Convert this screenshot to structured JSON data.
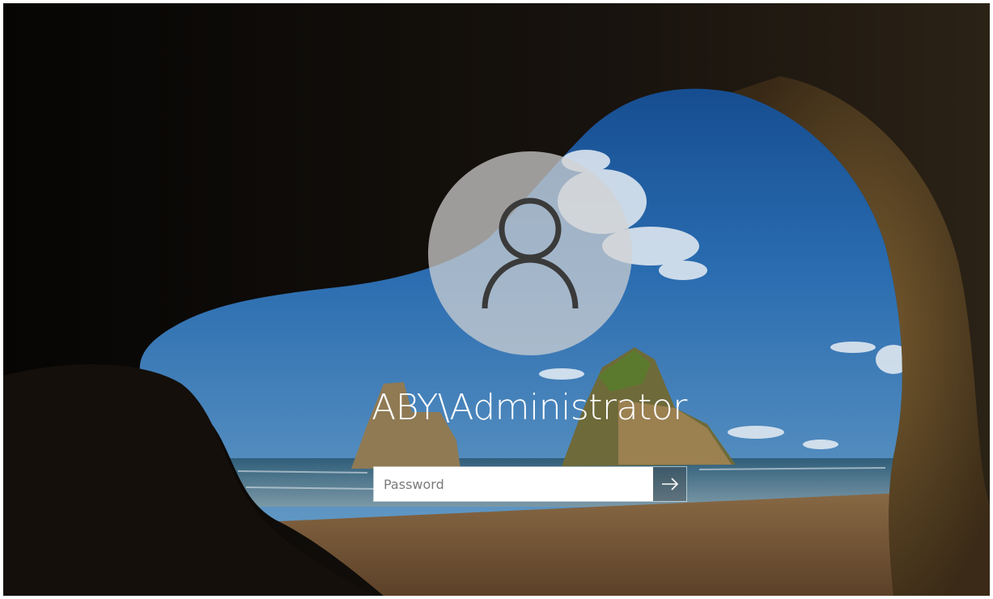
{
  "login": {
    "username": "ABY\\Administrator",
    "password_placeholder": "Password",
    "password_value": "",
    "submit_icon": "arrow-right-icon",
    "avatar_icon": "user-icon"
  },
  "colors": {
    "avatar_bg": "#d2d2d2",
    "text": "#ffffff",
    "input_bg": "#ffffff"
  }
}
